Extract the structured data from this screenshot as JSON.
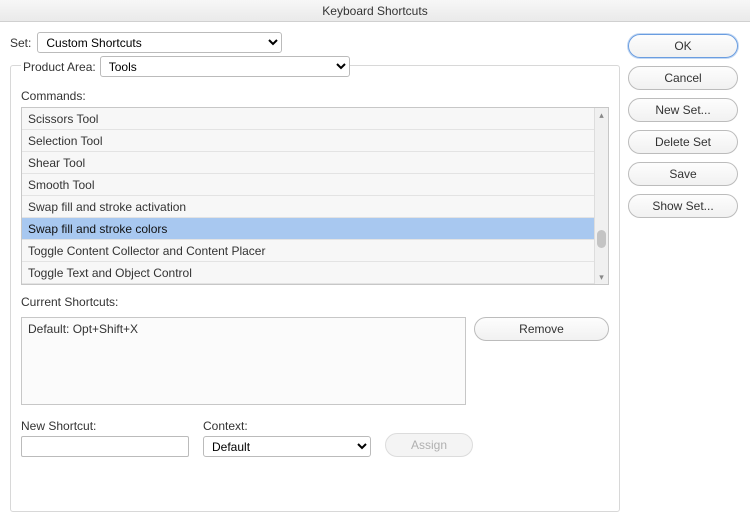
{
  "titlebar": "Keyboard Shortcuts",
  "labels": {
    "set": "Set:",
    "product_area": "Product Area:",
    "commands": "Commands:",
    "current_shortcuts": "Current Shortcuts:",
    "new_shortcut": "New Shortcut:",
    "context": "Context:"
  },
  "set_dropdown": {
    "value": "Custom Shortcuts"
  },
  "product_area_dropdown": {
    "value": "Tools"
  },
  "commands": [
    {
      "label": "Scissors Tool",
      "selected": false
    },
    {
      "label": "Selection Tool",
      "selected": false
    },
    {
      "label": "Shear Tool",
      "selected": false
    },
    {
      "label": "Smooth Tool",
      "selected": false
    },
    {
      "label": "Swap fill and stroke activation",
      "selected": false
    },
    {
      "label": "Swap fill and stroke colors",
      "selected": true
    },
    {
      "label": "Toggle Content Collector and Content Placer",
      "selected": false
    },
    {
      "label": "Toggle Text and Object Control",
      "selected": false
    }
  ],
  "current_shortcuts": [
    "Default: Opt+Shift+X"
  ],
  "new_shortcut_input": {
    "value": ""
  },
  "context_dropdown": {
    "value": "Default"
  },
  "buttons": {
    "ok": "OK",
    "cancel": "Cancel",
    "new_set": "New Set...",
    "delete_set": "Delete Set",
    "save": "Save",
    "show_set": "Show Set...",
    "remove": "Remove",
    "assign": "Assign"
  }
}
